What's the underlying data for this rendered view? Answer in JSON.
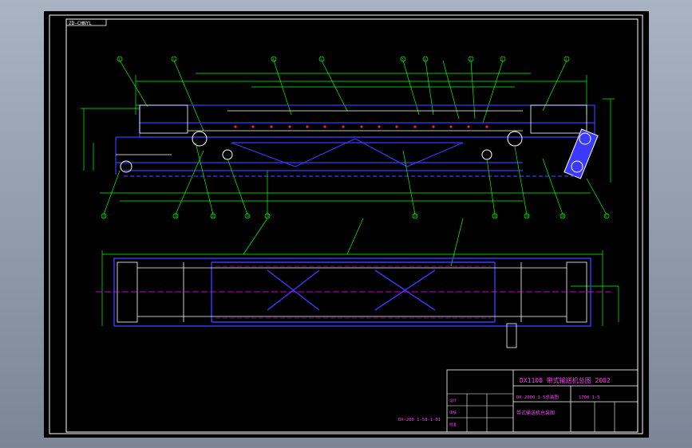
{
  "drawing": {
    "corner_tag": "ZD-CHNYL",
    "title_main": "DX1100 带式输送机总图 2002",
    "title_sub_left": "DX-2000 1-5总装图",
    "title_sub_right": "1700 1-5",
    "title_small": "带式输送机总装图",
    "left_note": "DX-200 1-58-1-01"
  },
  "colors": {
    "frame": "#ffffff",
    "structure": "#3a3aff",
    "annotation": "#00ff00",
    "centerline": "#ff00ff",
    "hidden": "#ffffff",
    "title_text": "#ff44ff"
  },
  "balloons_top": [
    "8",
    "3",
    "8",
    "7",
    "5",
    "3",
    "2",
    "2",
    "1"
  ],
  "balloons_bottom": [
    "11",
    "13",
    "12",
    "14",
    "10",
    "17",
    "16",
    "19",
    "20",
    "8"
  ]
}
